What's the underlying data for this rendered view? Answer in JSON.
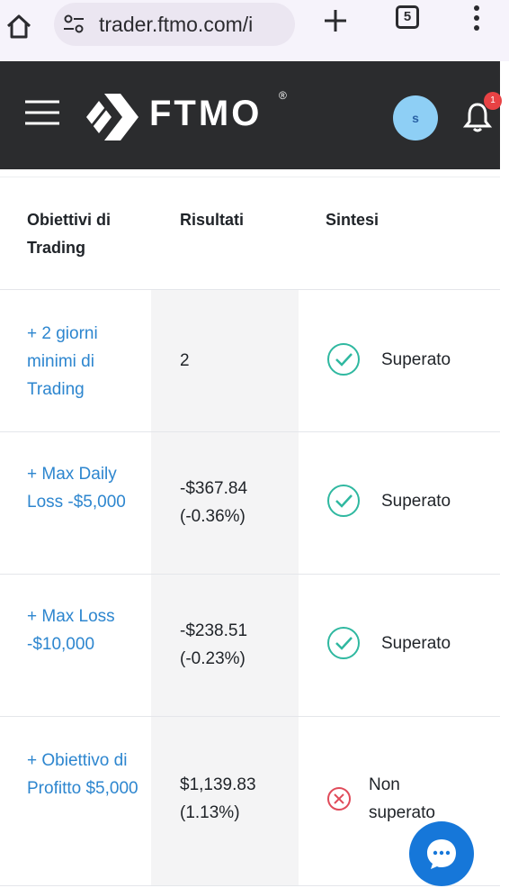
{
  "browser": {
    "url": "trader.ftmo.com/i",
    "tab_count": "5",
    "icons": [
      "home-icon",
      "tune-icon",
      "plus-icon",
      "tabs-icon",
      "more-vert-icon"
    ]
  },
  "header": {
    "brand": "FTMO",
    "registered": "®",
    "avatar_initial": "s",
    "notification_badge": "1",
    "colors": {
      "background": "#2b2c2e",
      "avatar": "#8ecff5",
      "badge": "#e84244"
    }
  },
  "table": {
    "columns": [
      "Obiettivi di Trading",
      "Risultati",
      "Sintesi"
    ],
    "rows": [
      {
        "goal": "+ 2 giorni minimi di Trading",
        "result": "2",
        "status": "Superato",
        "passed": true
      },
      {
        "goal": "+ Max Daily Loss -$5,000",
        "result": "-$367.84 (-0.36%)",
        "status": "Superato",
        "passed": true
      },
      {
        "goal": "+ Max Loss -$10,000",
        "result": "-$238.51 (-0.23%)",
        "status": "Superato",
        "passed": true
      },
      {
        "goal": "+ Obiettivo di Profitto $5,000",
        "result": "$1,139.83 (1.13%)",
        "status": "Non superato",
        "passed": false
      }
    ],
    "colors": {
      "link": "#2d86cf",
      "pass": "#2fb8a0",
      "fail": "#e04b5a",
      "shade": "#f4f4f5"
    }
  },
  "chat": {
    "icon": "chat-bubble-icon",
    "color": "#1677d9"
  }
}
